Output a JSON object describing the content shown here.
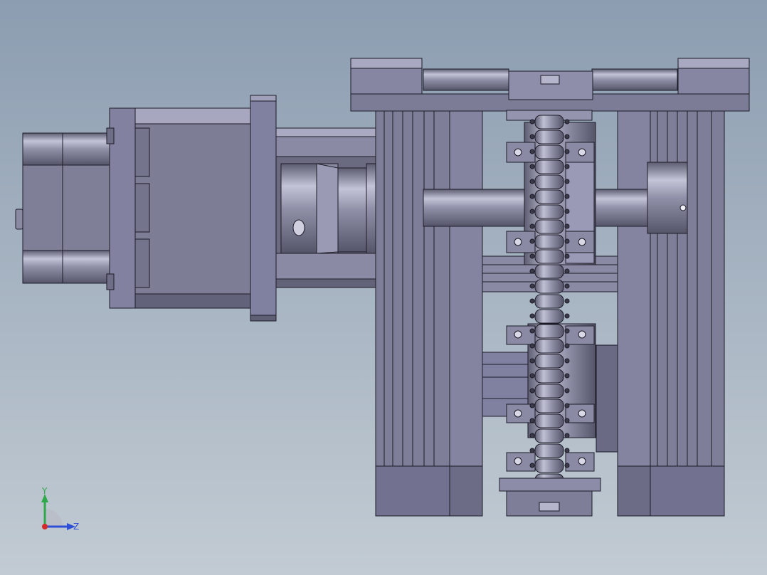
{
  "viewport": {
    "background_top": "#8c9db1",
    "background_bottom": "#c2cbd3"
  },
  "model": {
    "part_fill": "#7d7d95",
    "part_fill_light": "#a3a3bd",
    "part_fill_dark": "#5c5c70",
    "edge_color": "#1c1c28"
  },
  "triad": {
    "y_label": "Y",
    "z_label": "Z",
    "y_color": "#2fa84a",
    "z_color": "#2e4fd6",
    "x_color": "#d42a2a"
  }
}
